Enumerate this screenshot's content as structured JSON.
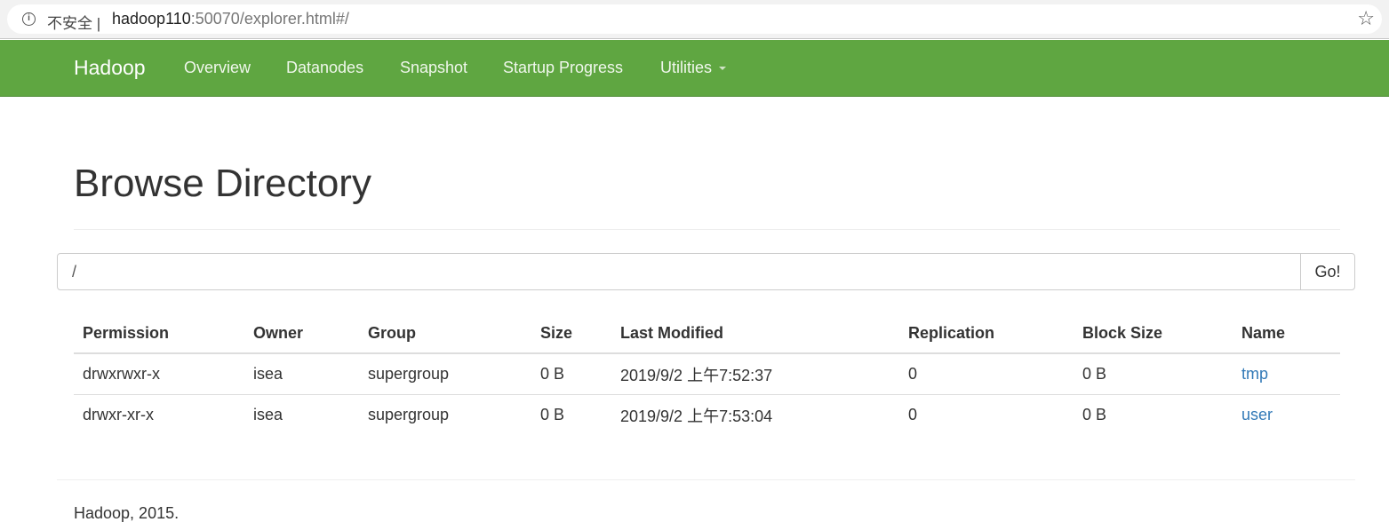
{
  "browser": {
    "security_label": "不安全",
    "url_host": "hadoop110",
    "url_rest": ":50070/explorer.html#/",
    "info_icon": "info-icon",
    "bookmark_icon": "star-icon"
  },
  "navbar": {
    "brand": "Hadoop",
    "items": [
      {
        "label": "Overview"
      },
      {
        "label": "Datanodes"
      },
      {
        "label": "Snapshot"
      },
      {
        "label": "Startup Progress"
      },
      {
        "label": "Utilities"
      }
    ],
    "bg_color": "#5fa641"
  },
  "page": {
    "title": "Browse Directory"
  },
  "path_bar": {
    "value": "/",
    "go_label": "Go!"
  },
  "table": {
    "columns": [
      "Permission",
      "Owner",
      "Group",
      "Size",
      "Last Modified",
      "Replication",
      "Block Size",
      "Name"
    ],
    "rows": [
      {
        "permission": "drwxrwxr-x",
        "owner": "isea",
        "group": "supergroup",
        "size": "0 B",
        "last_modified": "2019/9/2 上午7:52:37",
        "replication": "0",
        "block_size": "0 B",
        "name": "tmp"
      },
      {
        "permission": "drwxr-xr-x",
        "owner": "isea",
        "group": "supergroup",
        "size": "0 B",
        "last_modified": "2019/9/2 上午7:53:04",
        "replication": "0",
        "block_size": "0 B",
        "name": "user"
      }
    ],
    "link_color": "#337ab7"
  },
  "footer": {
    "text": "Hadoop, 2015."
  }
}
